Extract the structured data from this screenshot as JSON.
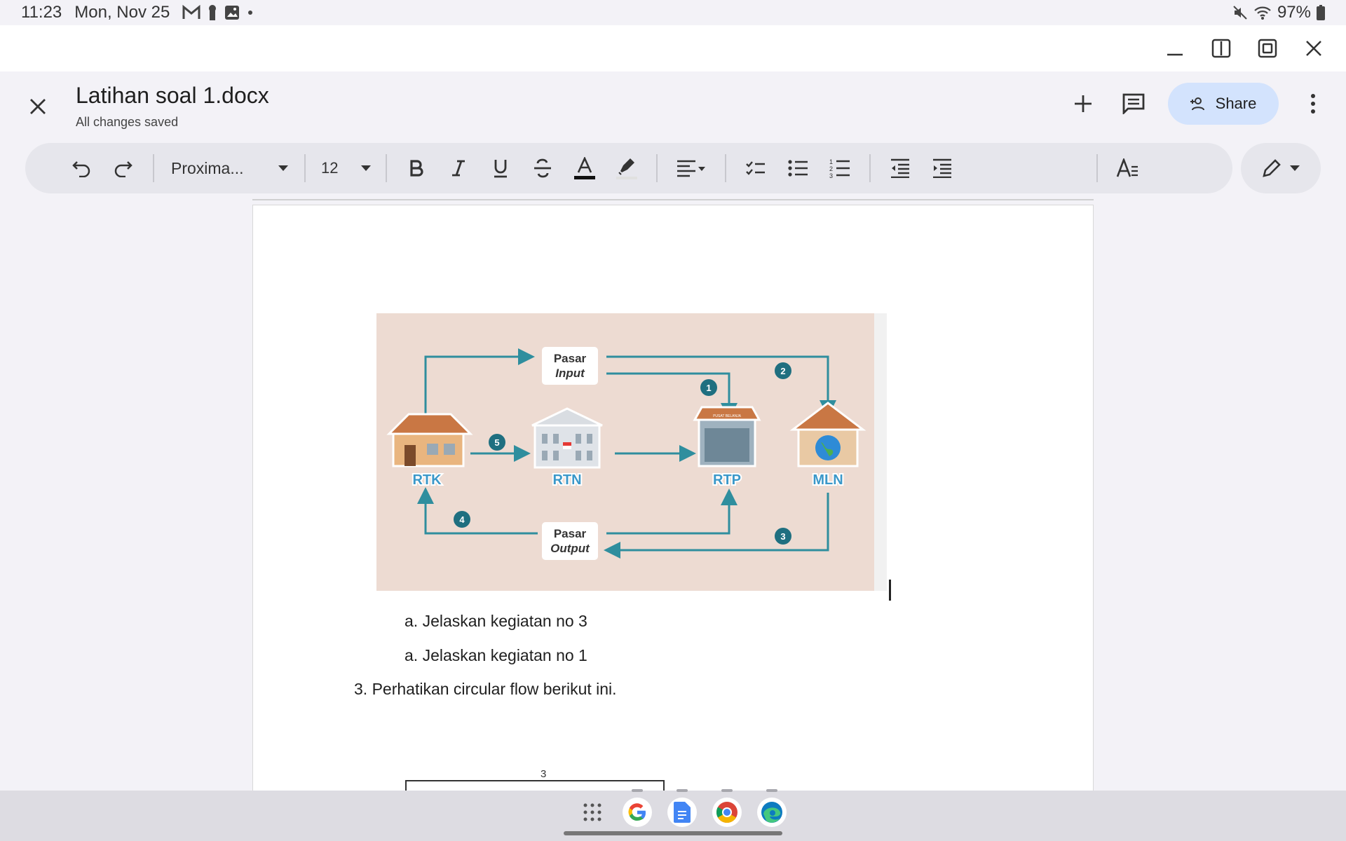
{
  "status_bar": {
    "time": "11:23",
    "date": "Mon, Nov 25",
    "battery": "97%",
    "icons": [
      "gmail-icon",
      "notification-icon",
      "gallery-icon",
      "dot-icon",
      "mute-icon",
      "wifi-icon",
      "battery-icon"
    ]
  },
  "document": {
    "title": "Latihan soal 1.docx",
    "save_status": "All changes saved",
    "share_label": "Share"
  },
  "toolbar": {
    "font_name": "Proxima...",
    "font_size": "12"
  },
  "diagram": {
    "pasar_input": [
      "Pasar",
      "Input"
    ],
    "pasar_output": [
      "Pasar",
      "Output"
    ],
    "nodes": [
      "RTK",
      "RTN",
      "RTP",
      "MLN"
    ],
    "numbers": [
      "1",
      "2",
      "3",
      "4",
      "5"
    ],
    "rtp_sign": "PUSAT BELANJA"
  },
  "content": {
    "line1": "a. Jelaskan kegiatan no 3",
    "line2": "a. Jelaskan kegiatan no 1",
    "line3": "3. Perhatikan circular flow berikut ini.",
    "box_label": "3"
  },
  "colors": {
    "accent": "#d3e3fd",
    "diagram_bg": "#eddbd2",
    "flow_line": "#2f8e9e",
    "badge": "#1f6f80"
  }
}
